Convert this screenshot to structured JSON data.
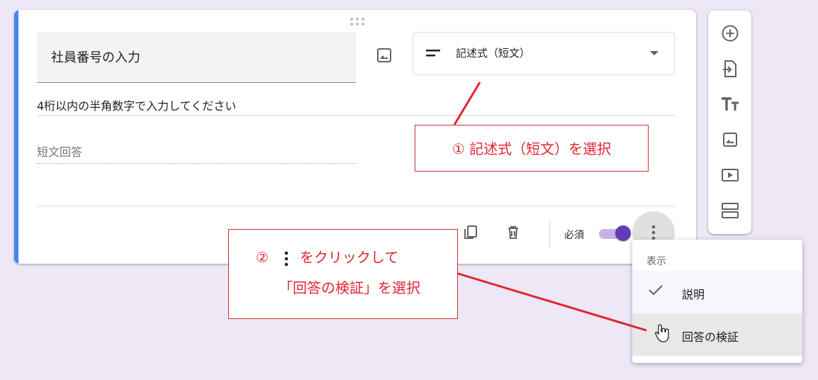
{
  "question": {
    "title": "社員番号の入力",
    "type_label": "記述式（短文）",
    "description": "4桁以内の半角数字で入力してください",
    "answer_placeholder": "短文回答",
    "required_label": "必須",
    "required_on": true,
    "accent_color": "#4285f4",
    "toggle_color": "#673ab7"
  },
  "menu": {
    "header": "表示",
    "items": [
      {
        "label": "説明",
        "checked": true
      },
      {
        "label": "回答の検証",
        "checked": false,
        "hovered": true
      }
    ]
  },
  "toolbar_icons": [
    "add-question-icon",
    "import-questions-icon",
    "add-title-icon",
    "add-image-icon",
    "add-video-icon",
    "add-section-icon"
  ],
  "annotations": {
    "step1": "① 記述式（短文）を選択",
    "step2_prefix": "②",
    "step2_suffix": "をクリックして",
    "step2_line2": "「回答の検証」を選択",
    "color": "#e0262f"
  }
}
